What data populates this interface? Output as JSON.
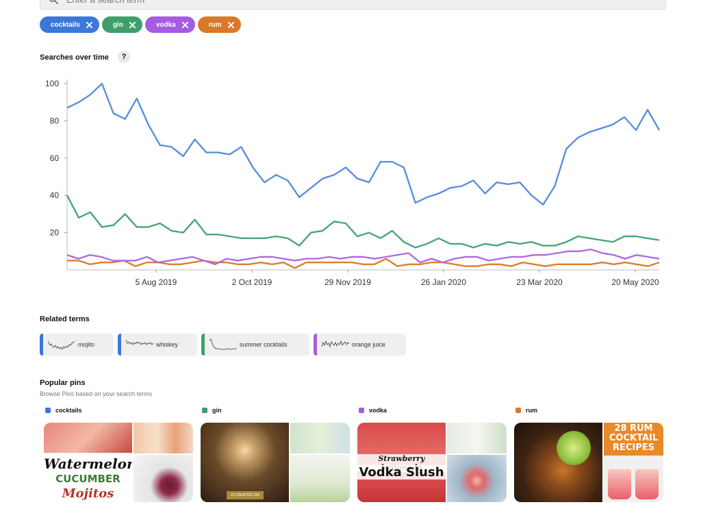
{
  "search": {
    "placeholder": "Enter a search term"
  },
  "chips": [
    {
      "label": "cocktails",
      "color": "#3b78d9"
    },
    {
      "label": "gin",
      "color": "#3f9e6c"
    },
    {
      "label": "vodka",
      "color": "#a55ce0"
    },
    {
      "label": "rum",
      "color": "#d9792c"
    }
  ],
  "searches": {
    "title": "Searches over time",
    "help": "?"
  },
  "chart_data": {
    "type": "line",
    "ylim": [
      0,
      100
    ],
    "yticks": [
      20,
      40,
      60,
      80,
      100
    ],
    "xticks": [
      "5 Aug 2019",
      "2 Oct 2019",
      "29 Nov 2019",
      "26 Jan 2020",
      "23 Mar 2020",
      "20 May 2020"
    ],
    "grid": false,
    "series": [
      {
        "name": "cocktails",
        "color": "#5b8fdc",
        "values": [
          87,
          90,
          94,
          100,
          84,
          81,
          92,
          78,
          67,
          66,
          61,
          70,
          63,
          63,
          62,
          66,
          55,
          47,
          51,
          48,
          39,
          44,
          49,
          51,
          55,
          49,
          47,
          58,
          58,
          55,
          36,
          39,
          41,
          44,
          45,
          48,
          41,
          47,
          46,
          47,
          40,
          35,
          45,
          65,
          71,
          74,
          76,
          78,
          82,
          75,
          86,
          75
        ]
      },
      {
        "name": "gin",
        "color": "#4aa574",
        "values": [
          40,
          28,
          31,
          23,
          24,
          30,
          23,
          23,
          25,
          21,
          20,
          27,
          19,
          19,
          18,
          17,
          17,
          17,
          18,
          17,
          13,
          20,
          21,
          26,
          25,
          18,
          20,
          17,
          21,
          15,
          12,
          14,
          17,
          14,
          14,
          12,
          14,
          13,
          15,
          14,
          15,
          13,
          13,
          15,
          18,
          17,
          16,
          15,
          18,
          18,
          17,
          16
        ]
      },
      {
        "name": "vodka",
        "color": "#b06be0",
        "values": [
          8,
          6,
          8,
          7,
          5,
          5,
          5,
          7,
          4,
          5,
          6,
          7,
          5,
          3,
          6,
          5,
          6,
          7,
          7,
          6,
          5,
          6,
          6,
          7,
          6,
          7,
          7,
          6,
          7,
          8,
          9,
          4,
          6,
          4,
          6,
          7,
          7,
          5,
          6,
          7,
          7,
          8,
          8,
          9,
          10,
          10,
          11,
          9,
          8,
          6,
          8,
          7,
          6
        ]
      },
      {
        "name": "rum",
        "color": "#dd7d2e",
        "values": [
          5,
          5,
          3,
          4,
          4,
          5,
          2,
          4,
          4,
          3,
          3,
          4,
          5,
          4,
          4,
          3,
          3,
          4,
          3,
          4,
          1,
          4,
          4,
          4,
          4,
          4,
          3,
          3,
          6,
          2,
          3,
          3,
          4,
          4,
          3,
          2,
          2,
          3,
          3,
          2,
          4,
          3,
          2,
          3,
          3,
          3,
          3,
          4,
          3,
          4,
          3,
          2,
          4
        ]
      }
    ]
  },
  "related": {
    "title": "Related terms",
    "terms": [
      {
        "label": "mojito",
        "color": "#3b78d9"
      },
      {
        "label": "whiskey",
        "color": "#3b78d9"
      },
      {
        "label": "summer cocktails",
        "color": "#3f9e6c"
      },
      {
        "label": "orange juice",
        "color": "#a55ce0"
      }
    ]
  },
  "pins": {
    "title": "Popular pins",
    "subtitle": "Browse Pins based on your search terms",
    "groups": [
      {
        "label": "cocktails",
        "color": "#3b78d9",
        "overlay": [
          "Watermelon",
          "CUCUMBER",
          "Mojitos"
        ]
      },
      {
        "label": "gin",
        "color": "#3f9e6c",
        "overlay": [
          "15 CREATIVE GIN"
        ]
      },
      {
        "label": "vodka",
        "color": "#a55ce0",
        "overlay": [
          "Strawberry lemonade",
          "Vodka Slush"
        ]
      },
      {
        "label": "rum",
        "color": "#d9792c",
        "overlay": [
          "28 RUM",
          "COCKTAIL",
          "RECIPES"
        ]
      }
    ]
  }
}
